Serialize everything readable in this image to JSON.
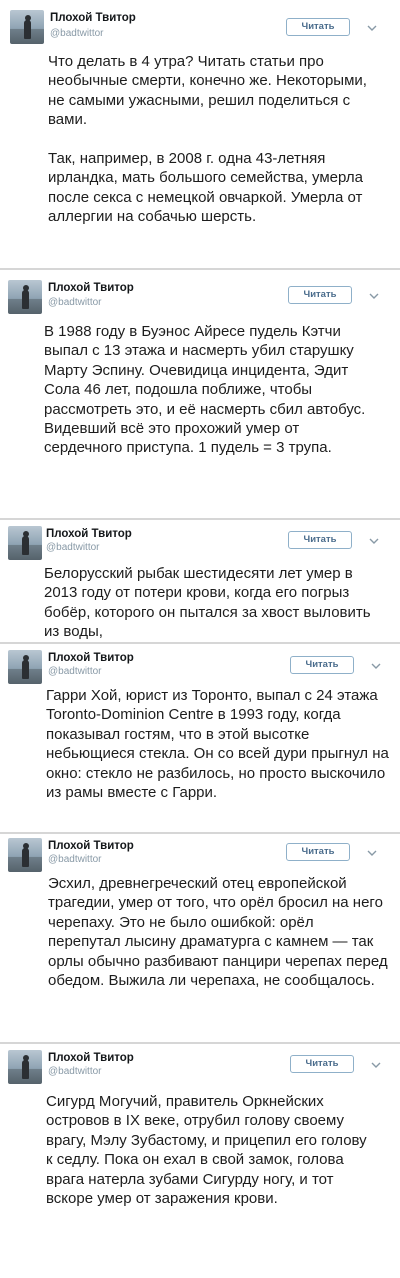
{
  "tweets": [
    {
      "author": "Плохой Твитор",
      "handle": "@badtwittor",
      "follow_label": "Читать",
      "text": "Что делать в 4 утра? Читать статьи про необычные смерти, конечно же. Некоторыми, не самыми ужасными, решил поделиться с вами.\n\nТак, например, в 2008 г. одна 43-летняя ирландка, мать большого семейства, умерла после секса с немецкой овчаркой. Умерла от аллергии на собачью шерсть."
    },
    {
      "author": "Плохой Твитор",
      "handle": "@badtwittor",
      "follow_label": "Читать",
      "text": "В 1988 году  в Буэнос Айресе пудель Кэтчи выпал с 13 этажа и насмерть убил старушку Марту Эспину. Очевидица инцидента, Эдит Сола 46 лет, подошла поближе, чтобы рассмотреть это, и её насмерть сбил автобус. Видевший всё это прохожий умер от сердечного приступа. 1 пудель = 3 трупа."
    },
    {
      "author": "Плохой Твитор",
      "handle": "@badtwittor",
      "follow_label": "Читать",
      "text": "Белорусский рыбак шестидесяти лет умер в 2013 году от потери крови, когда его погрыз бобёр, которого он пытался за хвост выловить из воды,"
    },
    {
      "author": "Плохой Твитор",
      "handle": "@badtwittor",
      "follow_label": "Читать",
      "text": "Гарри Хой, юрист из Торонто, выпал с 24 этажа Toronto-Dominion Centre в 1993 году, когда показывал гостям, что в этой высотке небьющиеся стекла. Он со всей дури прыгнул на окно: стекло не разбилось, но просто выскочило из рамы вместе с Гарри."
    },
    {
      "author": "Плохой Твитор",
      "handle": "@badtwittor",
      "follow_label": "Читать",
      "text": "Эсхил, древнегреческий отец европейской трагедии, умер от того, что орёл бросил на него черепаху. Это не было ошибкой: орёл перепутал лысину драматурга с камнем — так орлы обычно разбивают панцири черепах перед обедом. Выжила ли черепаха, не сообщалось."
    },
    {
      "author": "Плохой Твитор",
      "handle": "@badtwittor",
      "follow_label": "Читать",
      "text": "Сигурд Могучий, правитель Оркнейских островов в IX веке, отрубил голову своему врагу, Мэлу Зубастому, и прицепил его голову к седлу. Пока он ехал в свой замок, голова врага натерла зубами Сигурду ногу, и тот вскоре умер от заражения крови."
    }
  ]
}
